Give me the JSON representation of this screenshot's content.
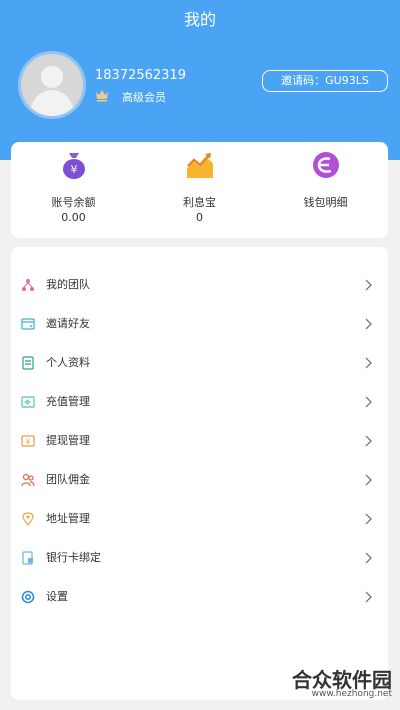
{
  "header": {
    "title": "我的"
  },
  "profile": {
    "phone": "18372562319",
    "level": "高级会员",
    "invite_code": "邀请码：GU93LS"
  },
  "stats": [
    {
      "label": "账号余额",
      "value": "0.00",
      "icon": "money-bag-icon"
    },
    {
      "label": "利息宝",
      "value": "0",
      "icon": "trend-chart-icon"
    },
    {
      "label": "钱包明细",
      "value": "",
      "icon": "wallet-detail-icon"
    }
  ],
  "menu": [
    {
      "label": "我的团队",
      "icon": "team-icon"
    },
    {
      "label": "邀请好友",
      "icon": "invite-icon"
    },
    {
      "label": "个人资料",
      "icon": "profile-icon"
    },
    {
      "label": "充值管理",
      "icon": "recharge-icon"
    },
    {
      "label": "提现管理",
      "icon": "withdraw-icon"
    },
    {
      "label": "团队佣金",
      "icon": "commission-icon"
    },
    {
      "label": "地址管理",
      "icon": "location-icon"
    },
    {
      "label": "银行卡绑定",
      "icon": "bank-card-icon"
    },
    {
      "label": "设置",
      "icon": "gear-icon"
    }
  ],
  "watermark": {
    "logo": "合众软件园",
    "url": "www.hezhong.net"
  },
  "colors": {
    "header_bg": "#4aa3f3",
    "page_bg": "#f1f1f1",
    "card_bg": "#ffffff"
  }
}
